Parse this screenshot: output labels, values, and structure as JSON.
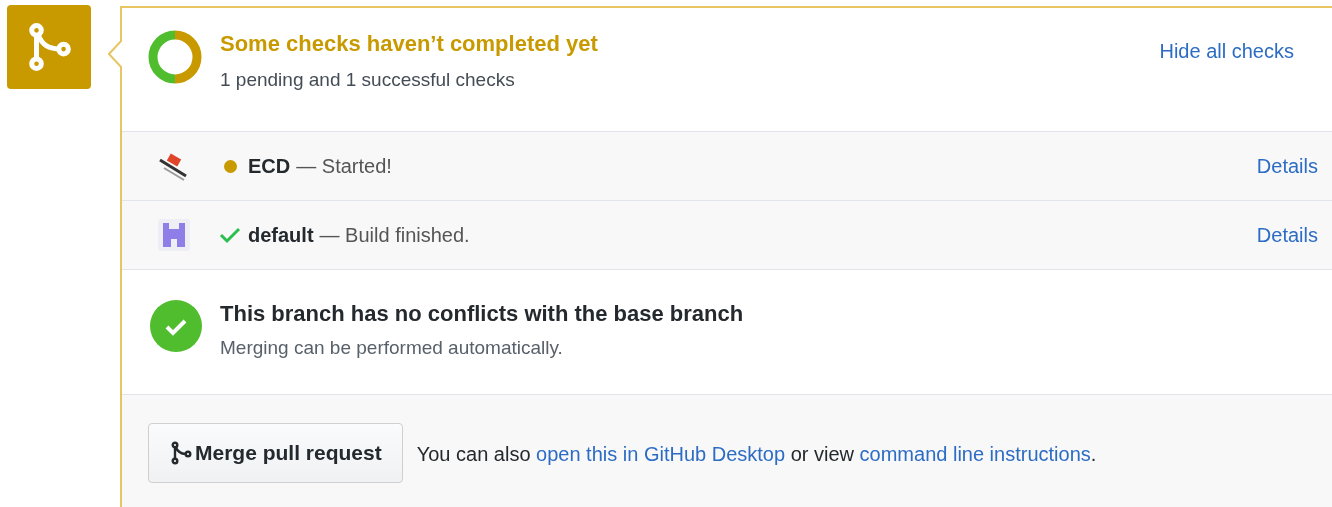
{
  "summary": {
    "title": "Some checks haven’t completed yet",
    "subtitle": "1 pending and 1 successful checks",
    "toggle": "Hide all checks"
  },
  "checks": [
    {
      "kind": "train",
      "completed": false,
      "name": "ECD",
      "description": "— Started!",
      "link": "Details"
    },
    {
      "kind": "castle",
      "completed": true,
      "name": "default",
      "description": "— Build finished.",
      "link": "Details"
    }
  ],
  "merge_status": {
    "title": "This branch has no conflicts with the base branch",
    "subtitle": "Merging can be performed automatically."
  },
  "merge": {
    "button": "Merge pull request",
    "parts": [
      {
        "kind": "text",
        "text": "You can also "
      },
      {
        "kind": "link",
        "text": "open this in GitHub Desktop"
      },
      {
        "kind": "text",
        "text": " or view "
      },
      {
        "kind": "link",
        "text": "command line instructions"
      },
      {
        "kind": "text",
        "text": "."
      }
    ]
  }
}
